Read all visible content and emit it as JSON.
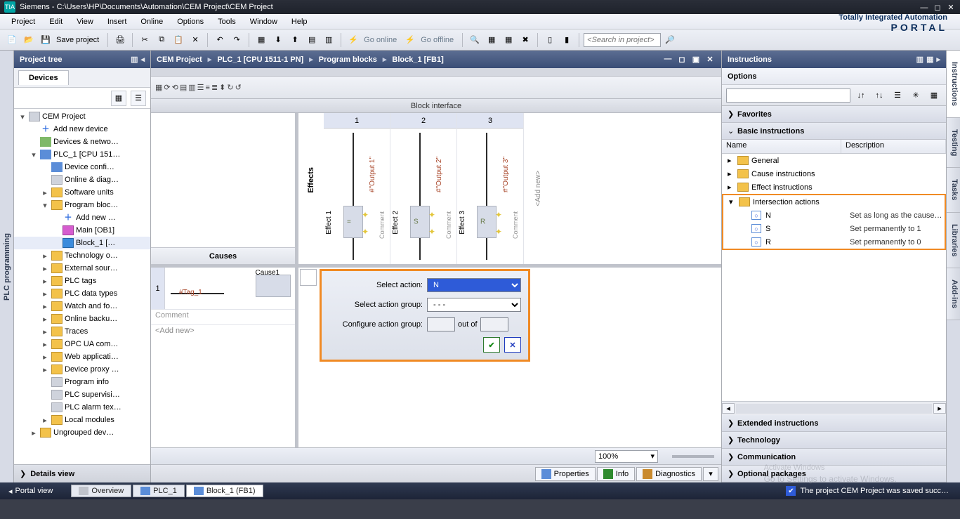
{
  "title": {
    "app": "Siemens",
    "path": "C:\\Users\\HP\\Documents\\Automation\\CEM Project\\CEM Project"
  },
  "menu": [
    "Project",
    "Edit",
    "View",
    "Insert",
    "Online",
    "Options",
    "Tools",
    "Window",
    "Help"
  ],
  "brand": {
    "line1": "Totally Integrated Automation",
    "line2": "PORTAL"
  },
  "toolbar": {
    "save": "Save project",
    "go_online": "Go online",
    "go_offline": "Go offline",
    "search_ph": "<Search in project>"
  },
  "left_tab": "PLC programming",
  "ptree": {
    "title": "Project tree",
    "tab": "Devices",
    "nodes": {
      "root": "CEM Project",
      "add_device": "Add new device",
      "dev_net": "Devices & netwo…",
      "plc": "PLC_1 [CPU 151…",
      "dev_cfg": "Device confi…",
      "online_diag": "Online & diag…",
      "sw_units": "Software units",
      "prog_block": "Program bloc…",
      "add_new": "Add new …",
      "main_ob": "Main [OB1]",
      "block1": "Block_1 […",
      "tech": "Technology o…",
      "ext_src": "External sour…",
      "plc_tags": "PLC tags",
      "plc_dt": "PLC data types",
      "watch": "Watch and fo…",
      "backup": "Online backu…",
      "traces": "Traces",
      "opc": "OPC UA com…",
      "web": "Web applicati…",
      "devproxy": "Device proxy …",
      "proginfo": "Program info",
      "supervis": "PLC supervisi…",
      "alarm": "PLC alarm tex…",
      "localmod": "Local modules",
      "ungrouped": "Ungrouped dev…"
    },
    "details": "Details view"
  },
  "crumb": [
    "CEM Project",
    "PLC_1 [CPU 1511-1 PN]",
    "Program blocks",
    "Block_1 [FB1]"
  ],
  "editor": {
    "block_if": "Block interface",
    "effects_label": "Effects",
    "causes_label": "Causes",
    "effects": [
      {
        "num": "1",
        "name": "Effect 1",
        "out": "#\"Output 1\"",
        "comment": "Comment",
        "action": "="
      },
      {
        "num": "2",
        "name": "Effect 2",
        "out": "#\"Output 2\"",
        "comment": "Comment",
        "action": "S"
      },
      {
        "num": "3",
        "name": "Effect 3",
        "out": "#\"Output 3\"",
        "comment": "Comment",
        "action": "R"
      }
    ],
    "add_new": "<Add new>",
    "cause": {
      "num": "1",
      "name": "Cause1",
      "eq": "=",
      "tag": "#Tag_1",
      "comment": "Comment",
      "add": "<Add new>"
    },
    "zoom": "100%"
  },
  "action": {
    "lbl_select": "Select action:",
    "lbl_group": "Select action group:",
    "lbl_cfg": "Configure action group:",
    "outof": "out of",
    "sel_action": "N",
    "sel_group": "- - -"
  },
  "propbar": {
    "props": "Properties",
    "info": "Info",
    "diag": "Diagnostics"
  },
  "instr": {
    "title": "Instructions",
    "options": "Options",
    "sections": {
      "fav": "Favorites",
      "basic": "Basic instructions",
      "ext": "Extended instructions",
      "tech": "Technology",
      "comm": "Communication",
      "opt": "Optional packages"
    },
    "headers": {
      "name": "Name",
      "desc": "Description"
    },
    "cats": {
      "general": "General",
      "cause": "Cause instructions",
      "effect": "Effect instructions",
      "inter": "Intersection actions"
    },
    "rows": [
      {
        "n": "N",
        "d": "Set as long as the cause…"
      },
      {
        "n": "S",
        "d": "Set permanently to 1"
      },
      {
        "n": "R",
        "d": "Set permanently to 0"
      }
    ]
  },
  "vtabs": [
    "Instructions",
    "Testing",
    "Tasks",
    "Libraries",
    "Add-ins"
  ],
  "status": {
    "portal": "Portal view",
    "tabs": [
      "Overview",
      "PLC_1",
      "Block_1 (FB1)"
    ],
    "msg": "The project CEM Project was saved succ…"
  },
  "watermark": {
    "l1": "Activate Windows",
    "l2": "Go to Settings to activate Windows."
  }
}
